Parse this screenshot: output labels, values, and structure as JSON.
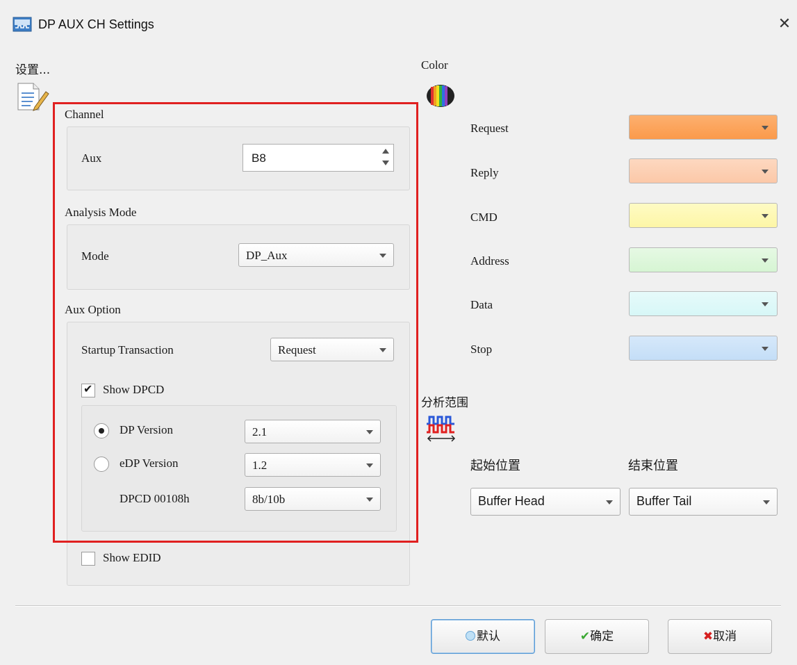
{
  "window": {
    "title": "DP AUX CH Settings",
    "close_glyph": "✕"
  },
  "settings_header": "设置...",
  "color_header": "Color",
  "channel": {
    "group_label": "Channel",
    "aux_label": "Aux",
    "aux_value": "B8"
  },
  "analysis_mode": {
    "group_label": "Analysis Mode",
    "mode_label": "Mode",
    "mode_value": "DP_Aux"
  },
  "aux_option": {
    "group_label": "Aux Option",
    "startup_label": "Startup Transaction",
    "startup_value": "Request",
    "show_dpcd_label": "Show DPCD",
    "show_dpcd_checked": true,
    "dp_version_label": "DP Version",
    "dp_version_value": "2.1",
    "dp_version_selected": true,
    "edp_version_label": "eDP Version",
    "edp_version_value": "1.2",
    "dpcd_00108h_label": "DPCD 00108h",
    "dpcd_00108h_value": "8b/10b",
    "show_edid_label": "Show EDID",
    "show_edid_checked": false
  },
  "colors": {
    "items": [
      {
        "label": "Request",
        "color": "#fb9a4b"
      },
      {
        "label": "Reply",
        "color": "#fcc8a8"
      },
      {
        "label": "CMD",
        "color": "#fdf6a6"
      },
      {
        "label": "Address",
        "color": "#d6f5d3"
      },
      {
        "label": "Data",
        "color": "#d7f7f7"
      },
      {
        "label": "Stop",
        "color": "#c4def7"
      }
    ]
  },
  "range": {
    "header": "分析范围",
    "start_label": "起始位置",
    "end_label": "结束位置",
    "start_value": "Buffer Head",
    "end_value": "Buffer Tail"
  },
  "buttons": {
    "default_label": "默认",
    "ok_label": "确定",
    "cancel_label": "取消"
  },
  "highlight_color": "#e02020"
}
